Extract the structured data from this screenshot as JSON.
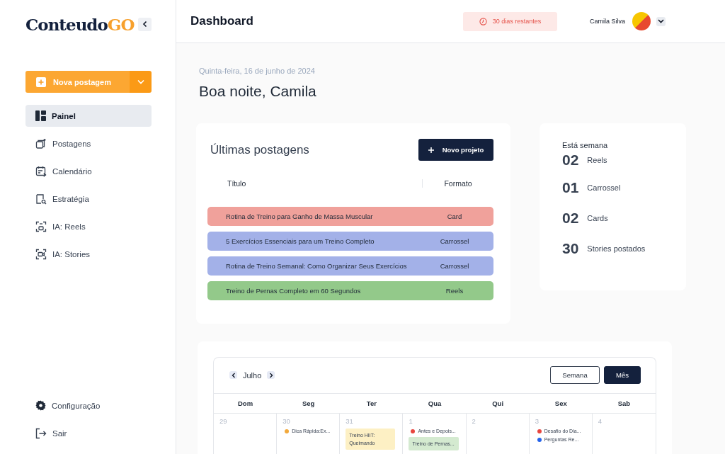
{
  "sidebar": {
    "logo": {
      "main": "Conteudo",
      "accent": "GO"
    },
    "new_post_button": "Nova postagem",
    "items": [
      {
        "label": "Painel",
        "kind": "grid",
        "selected": true
      },
      {
        "label": "Postagens",
        "kind": "posts",
        "selected": false
      },
      {
        "label": "Calendário",
        "kind": "calendar",
        "selected": false
      },
      {
        "label": "Estratégia",
        "kind": "strategy",
        "selected": false
      },
      {
        "label": "IA: Reels",
        "kind": "reels",
        "selected": false
      },
      {
        "label": "IA: Stories",
        "kind": "stories",
        "selected": false
      }
    ],
    "bottom_items": [
      {
        "label": "Configuração",
        "kind": "gear"
      },
      {
        "label": "Sair",
        "kind": "logout"
      }
    ]
  },
  "header": {
    "title": "Dashboard",
    "trial_badge": "30 dias restantes",
    "user_name": "Camila Silva"
  },
  "date": "Quinta-feira, 16 de junho de 2024",
  "greeting": "Boa noite, Camila",
  "latest_posts": {
    "title": "Últimas postagens",
    "button": "Novo projeto",
    "columns": [
      "Título",
      "Formato"
    ],
    "rows": [
      {
        "title": "Rotina de Treino para Ganho de Massa Muscular",
        "format": "Card",
        "color": "#f0a19b"
      },
      {
        "title": "5 Exercícios Essenciais para um Treino Completo",
        "format": "Carrossel",
        "color": "#a3b1e8"
      },
      {
        "title": "Rotina de Treino Semanal: Como Organizar Seus Exercícios",
        "format": "Carrossel",
        "color": "#a3b1e8"
      },
      {
        "title": "Treino de Pernas Completo em 60 Segundos",
        "format": "Reels",
        "color": "#93c98a"
      }
    ]
  },
  "week_stats": {
    "title": "Está semana",
    "items": [
      {
        "count": "02",
        "label": "Reels"
      },
      {
        "count": "01",
        "label": "Carrossel"
      },
      {
        "count": "02",
        "label": "Cards"
      },
      {
        "count": "30",
        "label": "Stories postados"
      }
    ]
  },
  "calendar": {
    "month": "Julho",
    "views": [
      {
        "label": "Semana",
        "selected": false
      },
      {
        "label": "Mês",
        "selected": true
      }
    ],
    "weekdays": [
      "Dom",
      "Seg",
      "Ter",
      "Qua",
      "Qui",
      "Sex",
      "Sab"
    ],
    "days": [
      {
        "day": "29"
      },
      {
        "day": "30",
        "events": [
          {
            "kind": "dot",
            "text": "Dica Rápida:Ex...",
            "color": "#f2a93b"
          }
        ]
      },
      {
        "day": "31",
        "events": [
          {
            "kind": "block",
            "text": "Treino HIIT: Queimando",
            "color": "#fdf0c4"
          }
        ]
      },
      {
        "day": "1",
        "events": [
          {
            "kind": "dot",
            "text": "Antes e Depois...",
            "color": "#e8463f"
          },
          {
            "kind": "block",
            "text": "Treino de Pernas...",
            "color": "#d4ead0"
          }
        ]
      },
      {
        "day": "2"
      },
      {
        "day": "3",
        "events": [
          {
            "kind": "dot",
            "text": "Desafio do Dia...",
            "color": "#e8463f"
          },
          {
            "kind": "dot",
            "text": "Perguntas Re...",
            "color": "#2563eb"
          }
        ]
      },
      {
        "day": "4"
      }
    ]
  }
}
